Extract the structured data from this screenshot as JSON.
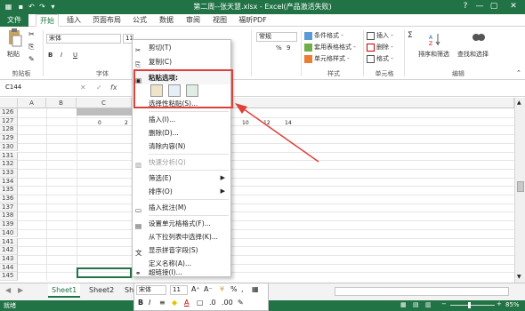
{
  "titlebar": {
    "title": "第二周--张天慧.xlsx - Excel(产品激活失败)",
    "help": "?",
    "minimize": "—",
    "restore": "▢",
    "close": "✕"
  },
  "tabs": [
    "文件",
    "开始",
    "插入",
    "页面布局",
    "公式",
    "数据",
    "审阅",
    "视图",
    "福昕PDF"
  ],
  "ribbon": {
    "paste_label": "粘贴",
    "clipboard_group": "剪贴板",
    "font_name": "宋体",
    "font_size": "11",
    "font_group": "字体",
    "bold": "B",
    "italic": "I",
    "underline": "U",
    "number_format": "常规",
    "percent": "%",
    "comma": "9",
    "style_group": "样式",
    "cond_format": "条件格式 -",
    "table_format": "套用表格格式 -",
    "cell_styles": "单元格样式 -",
    "insert": "插入 -",
    "delete": "删除 -",
    "format": "格式 -",
    "cells_group": "单元格",
    "sigma": "Σ",
    "sort_filter": "排序和筛选",
    "find_select": "查找和选择",
    "edit_group": "编辑"
  },
  "formula": {
    "namebox": "C144",
    "fx": "fx"
  },
  "grid": {
    "columns": [
      "A",
      "B",
      "C"
    ],
    "rows": [
      "126",
      "127",
      "128",
      "129",
      "130",
      "131",
      "132",
      "133",
      "134",
      "135",
      "136",
      "137",
      "138",
      "139",
      "140",
      "141",
      "142",
      "143",
      "144",
      "145"
    ],
    "row126_values": [
      "0",
      "2",
      "10",
      "12",
      "14"
    ]
  },
  "context_menu": {
    "items": [
      {
        "label": "剪切(T)",
        "icon": "scissors-icon"
      },
      {
        "label": "复制(C)",
        "icon": "copy-icon"
      },
      {
        "label": "粘贴选项:",
        "icon": "paste-icon"
      },
      {
        "label": "选择性粘贴(S)...",
        "icon": ""
      },
      {
        "label": "插入(I)...",
        "icon": ""
      },
      {
        "label": "删除(D)...",
        "icon": ""
      },
      {
        "label": "清除内容(N)",
        "icon": ""
      },
      {
        "label": "快速分析(Q)",
        "icon": "quick-analysis-icon"
      },
      {
        "label": "筛选(E)",
        "icon": ""
      },
      {
        "label": "排序(O)",
        "icon": ""
      },
      {
        "label": "插入批注(M)",
        "icon": "comment-icon"
      },
      {
        "label": "设置单元格格式(F)...",
        "icon": "format-cells-icon"
      },
      {
        "label": "从下拉列表中选择(K)...",
        "icon": ""
      },
      {
        "label": "显示拼音字段(S)",
        "icon": "pinyin-icon"
      },
      {
        "label": "定义名称(A)...",
        "icon": ""
      },
      {
        "label": "超链接(I)...",
        "icon": "hyperlink-icon"
      }
    ]
  },
  "mini_toolbar": {
    "font": "宋体",
    "size": "11",
    "bold": "B",
    "italic": "I",
    "font_color": "A"
  },
  "sheets": [
    "Sheet1",
    "Sheet2",
    "Sh"
  ],
  "status": {
    "ready": "就绪",
    "zoom": "85%",
    "minus": "−",
    "plus": "+"
  },
  "colors": {
    "excel_green": "#217346",
    "highlight_red": "#e0403a"
  }
}
